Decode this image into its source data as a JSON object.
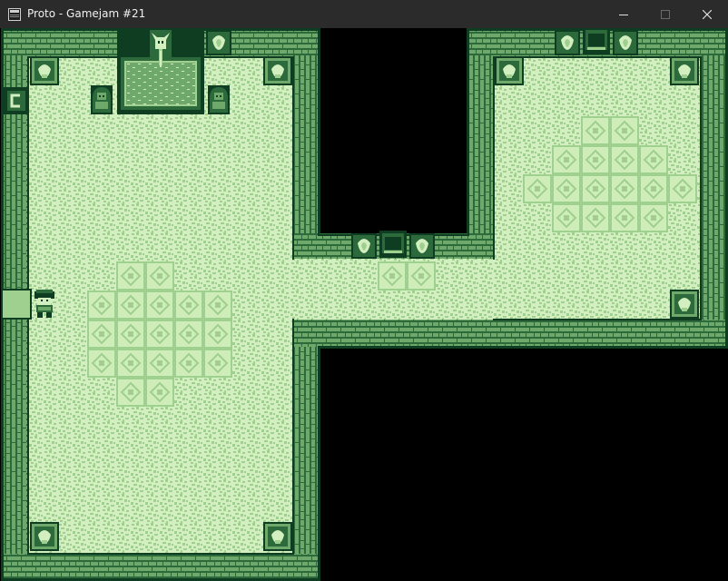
{
  "window": {
    "title": "Proto - Gamejam #21",
    "app_icon": "window-app-icon",
    "controls": [
      "minimize-icon",
      "maximize-icon",
      "close-icon"
    ]
  },
  "scene": {
    "palette": {
      "darkest": "#0f3d22",
      "dark": "#2c6a3c",
      "mid": "#6ea86a",
      "light": "#9fd08f",
      "lightest": "#d3efbf",
      "void": "#000000"
    },
    "objects": [
      "stone-brick-walls",
      "green-pool",
      "horned-skull-statue",
      "guardian-statue",
      "guardian-statue",
      "wall-torch",
      "corner-torch-pillar",
      "north-doorway",
      "doorway",
      "west-doorway",
      "west-exit",
      "player-character"
    ]
  }
}
